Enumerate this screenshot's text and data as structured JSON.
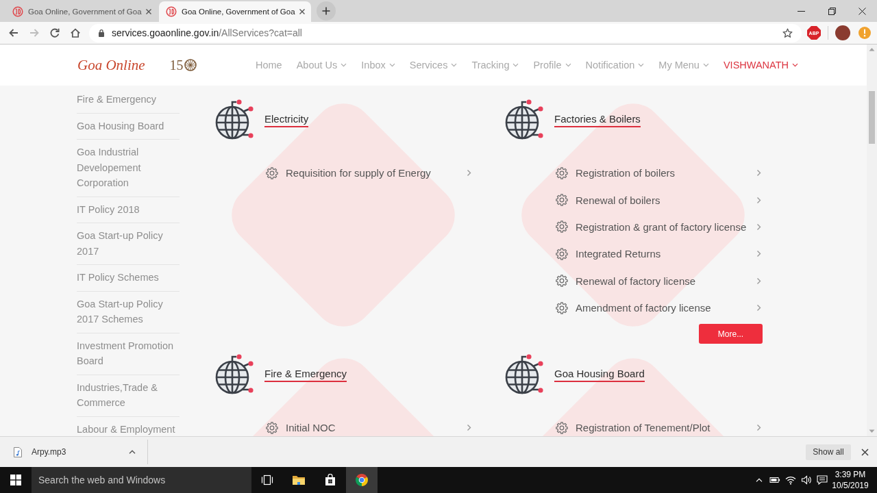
{
  "browser": {
    "tabs": [
      {
        "title": "Goa Online, Government of Goa",
        "selected": false
      },
      {
        "title": "Goa Online, Government of Goa",
        "selected": true
      }
    ],
    "nav_buttons": [
      {
        "disabled": false
      },
      {
        "disabled": true
      },
      {
        "disabled": false
      },
      {
        "disabled": false
      }
    ],
    "address": {
      "host": "services.goaonline.gov.in",
      "path": "/AllServices?cat=all"
    },
    "extension_badge": "ABP"
  },
  "site_header": {
    "logo": "Goa Online",
    "emblem_text": "15",
    "nav": [
      {
        "label": "Home",
        "dropdown": false,
        "kind": "link"
      },
      {
        "label": "About Us",
        "dropdown": true,
        "kind": "link"
      },
      {
        "label": "Inbox",
        "dropdown": true,
        "kind": "link"
      },
      {
        "label": "Services",
        "dropdown": true,
        "kind": "link"
      },
      {
        "label": "Tracking",
        "dropdown": true,
        "kind": "link"
      },
      {
        "label": "Profile",
        "dropdown": true,
        "kind": "link"
      },
      {
        "label": "Notification",
        "dropdown": true,
        "kind": "link"
      },
      {
        "label": "My Menu",
        "dropdown": true,
        "kind": "link"
      },
      {
        "label": "VISHWANATH",
        "dropdown": true,
        "kind": "user"
      }
    ]
  },
  "sidebar": {
    "items": [
      "Fire & Emergency",
      "Goa Housing Board",
      "Goa Industrial Developement Corporation",
      "IT Policy 2018",
      "Goa Start-up Policy 2017",
      "IT Policy Schemes",
      "Goa Start-up Policy 2017 Schemes",
      "Investment Promotion Board",
      "Industries,Trade & Commerce",
      "Labour & Employment"
    ]
  },
  "sections": [
    {
      "title": "Electricity",
      "services": [
        "Requisition for supply of Energy"
      ]
    },
    {
      "title": "Factories & Boilers",
      "services": [
        "Registration of boilers",
        "Renewal of boilers",
        "Registration & grant of factory license",
        "Integrated Returns",
        "Renewal of factory license",
        "Amendment of factory license"
      ],
      "more_button": "More..."
    },
    {
      "title": "Fire & Emergency",
      "services": [
        "Initial NOC"
      ]
    },
    {
      "title": "Goa Housing Board",
      "services": [
        "Registration of Tenement/Plot"
      ]
    }
  ],
  "downloads": {
    "file": "Arpy.mp3",
    "show_all": "Show all"
  },
  "taskbar": {
    "search_placeholder": "Search the web and Windows",
    "apps": [
      {
        "selected": false
      },
      {
        "selected": false
      },
      {
        "selected": false
      },
      {
        "selected": true
      }
    ],
    "time": "3:39 PM",
    "date": "10/5/2019"
  }
}
